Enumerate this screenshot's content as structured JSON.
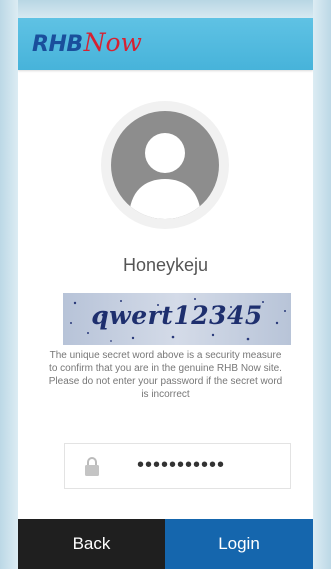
{
  "app": {
    "logo_bold": "RHB",
    "logo_script": "Now"
  },
  "colors": {
    "header": "#4fb9df",
    "logo_bold": "#1a4f9c",
    "logo_script": "#d62232",
    "back_button": "#1f1f1f",
    "login_button": "#1566ad"
  },
  "user": {
    "name": "Honeykeju",
    "avatar_icon": "person-silhouette-icon"
  },
  "secret": {
    "word": "qwert12345",
    "message": "The unique secret word above is a security measure to confirm that you are in the genuine RHB Now site. Please do not enter your password if the secret word is incorrect"
  },
  "password": {
    "icon": "lock-icon",
    "value": "•••••••••••"
  },
  "buttons": {
    "back": "Back",
    "login": "Login"
  }
}
